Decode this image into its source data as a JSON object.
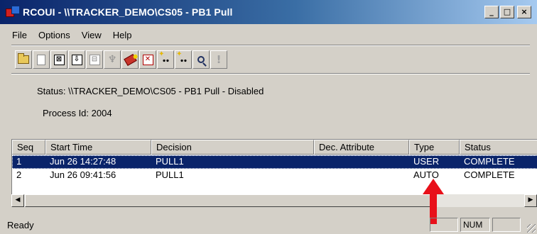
{
  "window": {
    "title": "RCOUI - \\\\TRACKER_DEMO\\CS05 - PB1 Pull",
    "minimize_label": "_",
    "maximize_label": "□",
    "close_label": "×"
  },
  "menu": {
    "items": [
      {
        "label": "File"
      },
      {
        "label": "Options"
      },
      {
        "label": "View"
      },
      {
        "label": "Help"
      }
    ]
  },
  "toolbar": {
    "buttons": [
      {
        "icon": "open-folder-icon"
      },
      {
        "icon": "new-document-icon"
      },
      {
        "icon": "stop-icon",
        "glyph": "⊠"
      },
      {
        "icon": "download-icon",
        "glyph": "⇩"
      },
      {
        "icon": "disabled-action-icon",
        "glyph": "⊟"
      },
      {
        "icon": "disabled-filter-icon",
        "glyph": "♆"
      },
      {
        "icon": "tag-icon"
      },
      {
        "icon": "delete-icon",
        "glyph": "✕"
      },
      {
        "icon": "find-icon",
        "glyph": "⚫⚫"
      },
      {
        "icon": "find-next-icon",
        "glyph": "⚫⚫"
      },
      {
        "icon": "search-icon"
      },
      {
        "icon": "exclamation-icon",
        "glyph": "!"
      }
    ]
  },
  "status": {
    "status_text": "Status:  \\\\TRACKER_DEMO\\CS05 - PB1 Pull - Disabled",
    "process_id_text": "Process Id: 2004"
  },
  "table": {
    "columns": [
      "Seq",
      "Start Time",
      "Decision",
      "Dec. Attribute",
      "Type",
      "Status"
    ],
    "rows": [
      {
        "seq": "1",
        "start_time": "Jun 26 14:27:48",
        "decision": "PULL1",
        "dec_attribute": "",
        "type": "USER",
        "status": "COMPLETE",
        "selected": true
      },
      {
        "seq": "2",
        "start_time": "Jun 26 09:41:56",
        "decision": "PULL1",
        "dec_attribute": "",
        "type": "AUTO",
        "status": "COMPLETE",
        "selected": false
      }
    ]
  },
  "statusbar": {
    "text": "Ready",
    "num_indicator": "NUM"
  },
  "colors": {
    "title_bar": "#0a246a",
    "selection": "#0a246a",
    "annotation_arrow": "#e8101a"
  }
}
